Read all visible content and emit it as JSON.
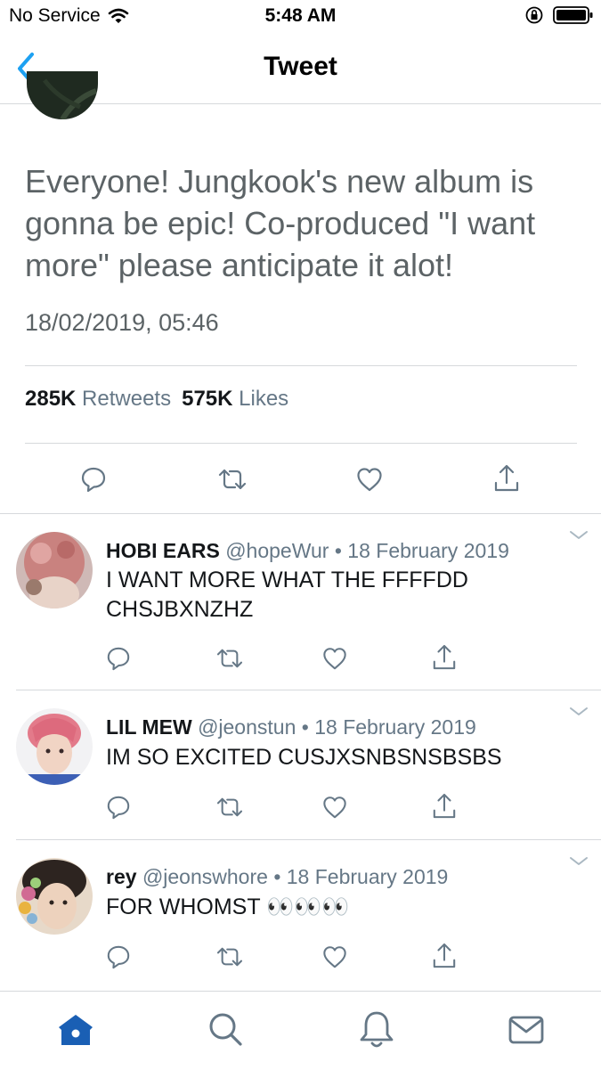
{
  "status_bar": {
    "carrier": "No Service",
    "time": "5:48 AM"
  },
  "header": {
    "title": "Tweet"
  },
  "tweet": {
    "text": "Everyone! Jungkook's new album is gonna be epic! Co-produced \"I want more\" please anticipate it alot!",
    "timestamp": "18/02/2019, 05:46",
    "retweets_count": "285K",
    "retweets_label": "Retweets",
    "likes_count": "575K",
    "likes_label": "Likes"
  },
  "replies": [
    {
      "name": "HOBI EARS",
      "handle": "@hopeWur",
      "sep": "•",
      "date": "18 February 2019",
      "text": "I WANT MORE WHAT THE FFFFDD CHSJBXNZHZ"
    },
    {
      "name": "LIL MEW",
      "handle": "@jeonstun",
      "sep": "•",
      "date": "18 February 2019",
      "text": "IM SO EXCITED CUSJXSNBSNSBSBS"
    },
    {
      "name": "rey",
      "handle": "@jeonswhore",
      "sep": "•",
      "date": "18 February 2019",
      "text": "FOR WHOMST 👀👀👀"
    }
  ],
  "colors": {
    "accent": "#1da1f2",
    "icon_gray": "#657786",
    "tab_active": "#1a5fb4",
    "text_gray": "#5c6366"
  },
  "icons": {
    "back": "chevron-left-icon",
    "reply": "speech-bubble-icon",
    "retweet": "retweet-icon",
    "like": "heart-icon",
    "share": "share-icon",
    "home": "home-icon",
    "search": "search-icon",
    "notifications": "bell-icon",
    "messages": "envelope-icon"
  }
}
